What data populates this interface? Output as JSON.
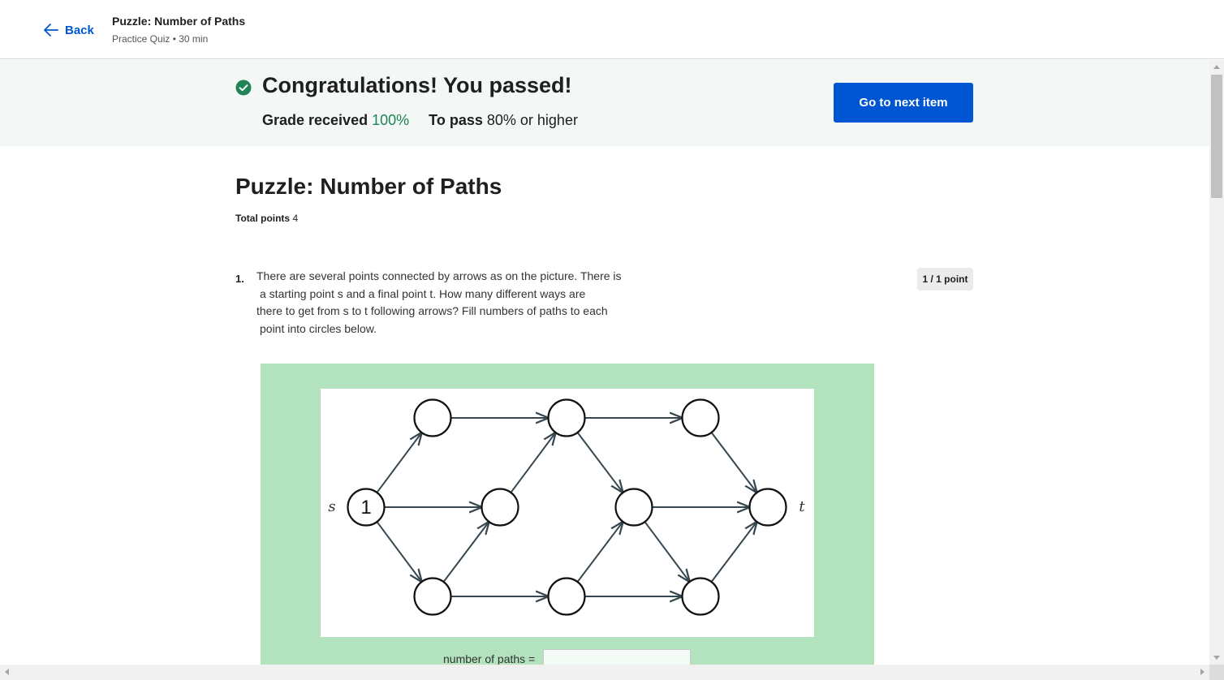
{
  "header": {
    "back_label": "Back",
    "back_icon": "arrow-left-icon",
    "quiz_title": "Puzzle: Number of Paths",
    "quiz_subtitle": "Practice Quiz • 30 min"
  },
  "result": {
    "icon": "check-circle-icon",
    "title": "Congratulations! You passed!",
    "grade_label": "Grade received",
    "grade_value": "100%",
    "pass_label": "To pass",
    "pass_value": "80% or higher",
    "next_button": "Go to next item"
  },
  "quiz": {
    "title": "Puzzle: Number of Paths",
    "total_points_label": "Total points",
    "total_points_value": "4"
  },
  "question": {
    "number": "1.",
    "text_lines": [
      "There are several points connected by arrows as on the picture. There is",
      "a starting point s and a final point t. How many different ways are",
      "there to get from s to t following arrows? Fill numbers of paths to each",
      "point into circles below."
    ],
    "points": "1 / 1 point",
    "graph": {
      "start_label": "s",
      "end_label": "t",
      "start_value": "1"
    },
    "answer_label": "number of paths =",
    "answer_value": ""
  },
  "colors": {
    "accent": "#0056d2",
    "success": "#1f8354",
    "banner_bg": "#f3f8f6",
    "puzzle_bg": "#b3e3be",
    "arrow": "#37474f"
  }
}
